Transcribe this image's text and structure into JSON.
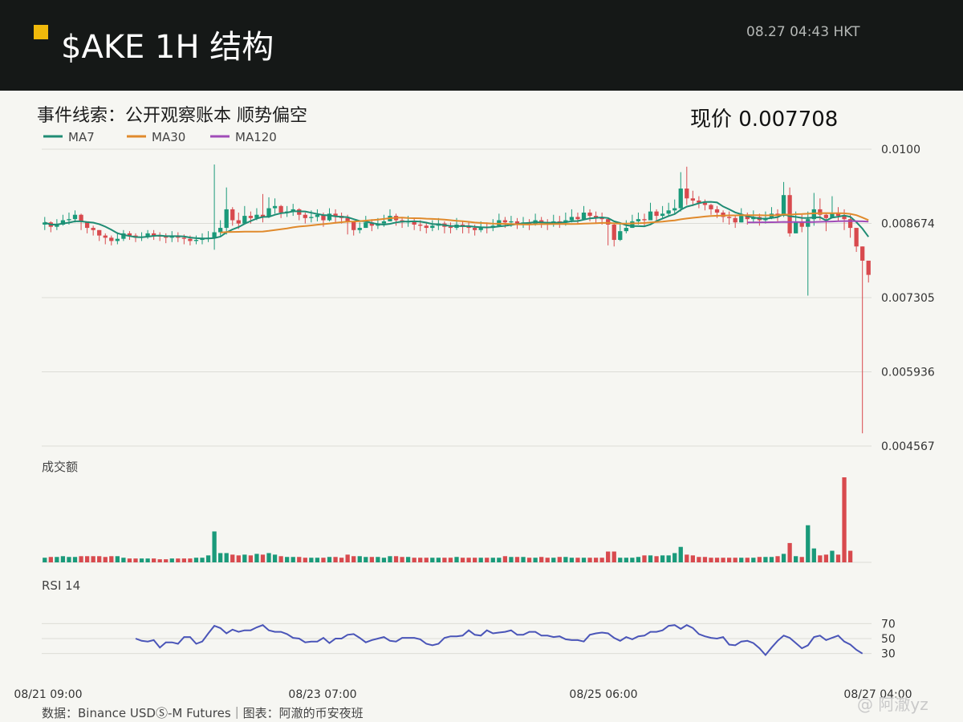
{
  "header": {
    "title": "$AKE  1H 结构",
    "timestamp": "08.27  04:43 HKT",
    "accent_color": "#f0b90b"
  },
  "subtitle": "事件线索：公开观察账本 顺势偏空",
  "price_label": "现价 0.007708",
  "footer": {
    "source": "数据：Binance USDⓈ-M Futures｜图表：阿澈的币安夜班",
    "watermark": "@ 阿澈yz"
  },
  "chart_data": {
    "type": "candlestick",
    "symbol": "$AKE",
    "interval": "1H",
    "price_axis": {
      "ticks": [
        "0.0100",
        "0.008674",
        "0.007305",
        "0.005936",
        "0.004567"
      ],
      "ylim": [
        0.004567,
        0.01
      ]
    },
    "time_axis": {
      "ticks": [
        "08/21 09:00",
        "08/23 07:00",
        "08/25 06:00",
        "08/27 04:00"
      ]
    },
    "legend": [
      {
        "name": "MA7",
        "color": "#1f8c74"
      },
      {
        "name": "MA30",
        "color": "#e08a2c"
      },
      {
        "name": "MA120",
        "color": "#a04cb8"
      }
    ],
    "colors": {
      "up": "#1a9a7a",
      "down": "#d84a4e",
      "rsi": "#4a55b8"
    },
    "volume_panel": {
      "label": "成交额"
    },
    "rsi_panel": {
      "label": "RSI 14",
      "ticks": [
        70,
        50,
        30
      ],
      "ylim": [
        20,
        80
      ]
    },
    "closes": [
      0.00866,
      0.00858,
      0.00862,
      0.0087,
      0.00872,
      0.0088,
      0.00868,
      0.00856,
      0.00852,
      0.00842,
      0.00838,
      0.00832,
      0.00836,
      0.00846,
      0.00842,
      0.00838,
      0.0084,
      0.00846,
      0.00842,
      0.0084,
      0.00838,
      0.00842,
      0.00838,
      0.00836,
      0.00832,
      0.00834,
      0.00836,
      0.00838,
      0.00848,
      0.00856,
      0.0089,
      0.0087,
      0.00864,
      0.00878,
      0.00874,
      0.0088,
      0.00876,
      0.00892,
      0.00896,
      0.00884,
      0.00886,
      0.0089,
      0.0088,
      0.00874,
      0.00876,
      0.0088,
      0.0087,
      0.00882,
      0.00878,
      0.00874,
      0.00868,
      0.00852,
      0.00856,
      0.00866,
      0.0086,
      0.00864,
      0.00868,
      0.00878,
      0.0087,
      0.00866,
      0.00868,
      0.00862,
      0.0086,
      0.00856,
      0.0086,
      0.00864,
      0.00858,
      0.00856,
      0.00862,
      0.00858,
      0.00856,
      0.00852,
      0.00858,
      0.00856,
      0.0086,
      0.0087,
      0.00866,
      0.00868,
      0.00864,
      0.00866,
      0.00862,
      0.0087,
      0.00866,
      0.00862,
      0.00868,
      0.00866,
      0.0087,
      0.00876,
      0.00872,
      0.00884,
      0.00878,
      0.00874,
      0.00872,
      0.00862,
      0.00834,
      0.0085,
      0.00856,
      0.00868,
      0.00872,
      0.0087,
      0.00886,
      0.00878,
      0.00882,
      0.00888,
      0.00892,
      0.00928,
      0.0091,
      0.00906,
      0.00902,
      0.00898,
      0.0089,
      0.00884,
      0.00876,
      0.00874,
      0.00866,
      0.00878,
      0.00872,
      0.00876,
      0.0087,
      0.00874,
      0.00882,
      0.00878,
      0.00916,
      0.00846,
      0.00866,
      0.00858,
      0.00872,
      0.0089,
      0.0088,
      0.00874,
      0.00884,
      0.00878,
      0.00872,
      0.00856,
      0.00822,
      0.00796,
      0.0077
    ],
    "highs": [
      0.00876,
      0.00868,
      0.00872,
      0.0088,
      0.00884,
      0.00888,
      0.00882,
      0.00866,
      0.0086,
      0.00852,
      0.00846,
      0.00842,
      0.00848,
      0.00852,
      0.0085,
      0.00846,
      0.00848,
      0.00852,
      0.00852,
      0.00848,
      0.00846,
      0.0085,
      0.00848,
      0.00844,
      0.00842,
      0.00842,
      0.00846,
      0.0085,
      0.00972,
      0.0087,
      0.0093,
      0.00894,
      0.00884,
      0.00896,
      0.00886,
      0.00892,
      0.00918,
      0.00912,
      0.0091,
      0.00898,
      0.00896,
      0.009,
      0.00892,
      0.00884,
      0.00888,
      0.0089,
      0.00884,
      0.00892,
      0.0089,
      0.00884,
      0.0088,
      0.00866,
      0.00866,
      0.00878,
      0.00872,
      0.00874,
      0.0088,
      0.0089,
      0.00882,
      0.00876,
      0.00878,
      0.00874,
      0.0087,
      0.00866,
      0.0087,
      0.00874,
      0.00868,
      0.00866,
      0.00874,
      0.00868,
      0.00866,
      0.00862,
      0.00868,
      0.00866,
      0.00872,
      0.00882,
      0.00876,
      0.00878,
      0.00874,
      0.00876,
      0.00872,
      0.00882,
      0.00876,
      0.00872,
      0.0088,
      0.00878,
      0.00884,
      0.0089,
      0.00884,
      0.00896,
      0.0089,
      0.00886,
      0.00884,
      0.00874,
      0.00864,
      0.00866,
      0.0087,
      0.0088,
      0.00884,
      0.00882,
      0.00902,
      0.0089,
      0.00896,
      0.00902,
      0.00908,
      0.00958,
      0.00968,
      0.00924,
      0.00914,
      0.00908,
      0.009,
      0.00896,
      0.00888,
      0.00886,
      0.0088,
      0.00892,
      0.00884,
      0.00888,
      0.00882,
      0.00886,
      0.00894,
      0.0089,
      0.0094,
      0.0093,
      0.00886,
      0.0088,
      0.00886,
      0.0092,
      0.0091,
      0.00884,
      0.00914,
      0.00894,
      0.0089,
      0.0088,
      0.00844,
      0.00822,
      0.00786
    ],
    "lows": [
      0.00852,
      0.00848,
      0.00852,
      0.0086,
      0.00862,
      0.00866,
      0.00852,
      0.00846,
      0.00842,
      0.00832,
      0.00826,
      0.00824,
      0.00826,
      0.00832,
      0.00834,
      0.0083,
      0.00832,
      0.00836,
      0.00834,
      0.00832,
      0.00828,
      0.0083,
      0.0083,
      0.00826,
      0.00824,
      0.00826,
      0.00826,
      0.0083,
      0.00816,
      0.00842,
      0.00844,
      0.0086,
      0.00854,
      0.00864,
      0.00864,
      0.0087,
      0.00866,
      0.00874,
      0.00882,
      0.00874,
      0.00876,
      0.00878,
      0.0087,
      0.00864,
      0.00866,
      0.00868,
      0.00858,
      0.00868,
      0.00864,
      0.00864,
      0.00844,
      0.00842,
      0.00846,
      0.00856,
      0.0085,
      0.00854,
      0.00858,
      0.00868,
      0.0086,
      0.00856,
      0.00858,
      0.00852,
      0.0085,
      0.00846,
      0.0085,
      0.00852,
      0.00846,
      0.00846,
      0.00852,
      0.00846,
      0.00846,
      0.00842,
      0.00848,
      0.00846,
      0.0085,
      0.0086,
      0.00856,
      0.00858,
      0.00854,
      0.00856,
      0.00852,
      0.0086,
      0.00856,
      0.00852,
      0.00858,
      0.00856,
      0.0086,
      0.00866,
      0.00862,
      0.00874,
      0.00868,
      0.00864,
      0.00862,
      0.00824,
      0.00822,
      0.00832,
      0.00846,
      0.00856,
      0.00862,
      0.0086,
      0.00876,
      0.00868,
      0.00872,
      0.00878,
      0.00882,
      0.00886,
      0.00898,
      0.00896,
      0.00892,
      0.00888,
      0.0088,
      0.00874,
      0.00866,
      0.00862,
      0.00856,
      0.00866,
      0.00862,
      0.00866,
      0.0086,
      0.00864,
      0.00872,
      0.00868,
      0.00876,
      0.0084,
      0.00846,
      0.00848,
      0.00732,
      0.0086,
      0.0087,
      0.0085,
      0.00874,
      0.00868,
      0.00852,
      0.00838,
      0.00812,
      0.0048,
      0.00756
    ],
    "volumes": [
      6,
      7,
      7,
      8,
      7,
      7,
      8,
      8,
      8,
      8,
      7,
      8,
      8,
      6,
      5,
      5,
      5,
      5,
      5,
      4,
      4,
      5,
      5,
      5,
      5,
      6,
      6,
      9,
      40,
      12,
      12,
      10,
      9,
      10,
      9,
      11,
      10,
      12,
      10,
      8,
      7,
      7,
      7,
      6,
      6,
      6,
      6,
      7,
      7,
      6,
      10,
      8,
      8,
      7,
      7,
      7,
      6,
      8,
      8,
      7,
      7,
      6,
      6,
      6,
      6,
      6,
      6,
      6,
      7,
      6,
      6,
      6,
      6,
      6,
      6,
      6,
      8,
      7,
      7,
      7,
      6,
      6,
      7,
      6,
      6,
      7,
      7,
      6,
      6,
      6,
      6,
      6,
      6,
      14,
      14,
      6,
      6,
      6,
      7,
      9,
      9,
      8,
      9,
      9,
      12,
      20,
      10,
      9,
      7,
      7,
      6,
      6,
      6,
      6,
      6,
      6,
      6,
      6,
      7,
      7,
      7,
      8,
      11,
      25,
      8,
      7,
      48,
      18,
      9,
      10,
      15,
      10,
      110,
      15
    ],
    "rsi": [
      null,
      null,
      null,
      null,
      null,
      null,
      null,
      null,
      null,
      null,
      null,
      null,
      null,
      null,
      null,
      50,
      47,
      46,
      48,
      38,
      45,
      45,
      43,
      52,
      52,
      43,
      46,
      57,
      67,
      64,
      57,
      62,
      59,
      61,
      61,
      65,
      68,
      61,
      59,
      59,
      56,
      51,
      50,
      45,
      46,
      46,
      51,
      44,
      50,
      50,
      55,
      56,
      51,
      45,
      48,
      50,
      52,
      47,
      46,
      51,
      51,
      51,
      49,
      43,
      41,
      43,
      51,
      53,
      53,
      54,
      61,
      55,
      54,
      61,
      57,
      58,
      59,
      61,
      55,
      55,
      59,
      59,
      54,
      54,
      52,
      53,
      49,
      48,
      48,
      46,
      55,
      57,
      58,
      57,
      51,
      47,
      52,
      49,
      53,
      54,
      59,
      59,
      61,
      67,
      68,
      63,
      68,
      64,
      56,
      53,
      51,
      50,
      52,
      42,
      41,
      46,
      47,
      44,
      37,
      28,
      38,
      47,
      54,
      51,
      44,
      37,
      41,
      52,
      54,
      48,
      51,
      54,
      46,
      42,
      35,
      30
    ]
  }
}
